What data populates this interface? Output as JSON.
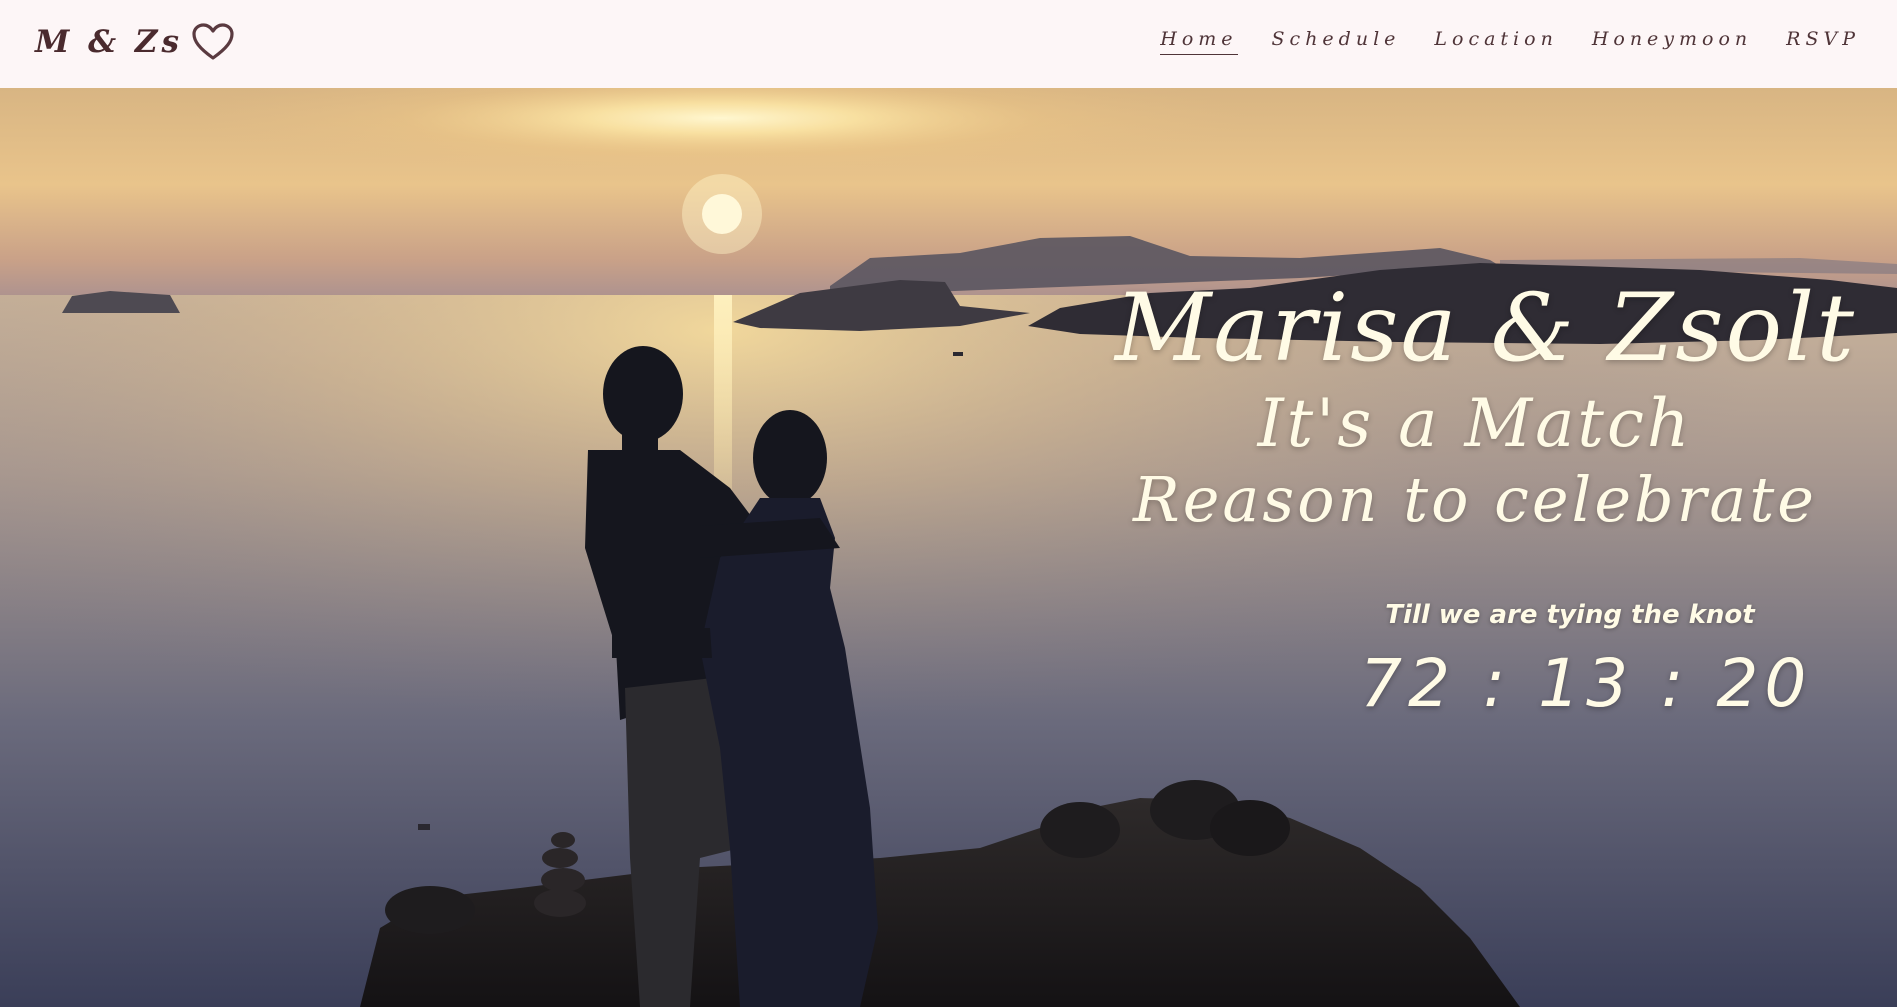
{
  "header": {
    "brand": "M & Zs",
    "brand_icon": "heart-outline-icon",
    "nav": [
      {
        "label": "Home",
        "active": true
      },
      {
        "label": "Schedule",
        "active": false
      },
      {
        "label": "Location",
        "active": false
      },
      {
        "label": "Honeymoon",
        "active": false
      },
      {
        "label": "RSVP",
        "active": false
      }
    ]
  },
  "hero": {
    "names": "Marisa & Zsolt",
    "tagline_1": "It's a Match",
    "tagline_2": "Reason to celebrate",
    "countdown_caption": "Till we are tying the knot",
    "countdown": "72 : 13 : 20"
  },
  "colors": {
    "header_bg": "#fdf6f7",
    "nav_text": "#4f3438",
    "brand_text": "#4a2a2e",
    "hero_text": "#fffbe6"
  }
}
